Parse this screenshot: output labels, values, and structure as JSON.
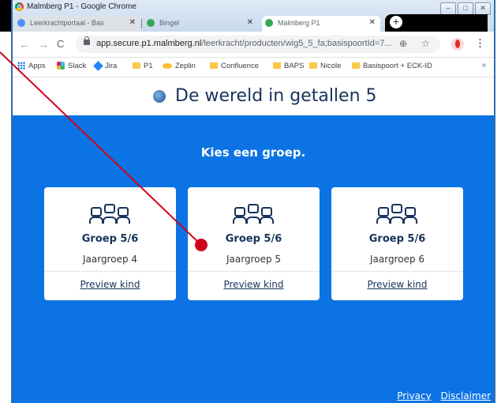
{
  "window": {
    "title": "Malmberg P1 - Google Chrome",
    "controls": [
      "–",
      "□",
      "✕"
    ]
  },
  "tabs": [
    {
      "label": "Leerkrachtportaal - Bas",
      "close": "✕",
      "icon_color": "#4d90fe"
    },
    {
      "label": "Bingel",
      "close": "✕",
      "icon_color": "#34a853"
    },
    {
      "label": "Malmberg P1",
      "close": "✕",
      "icon_color": "#34a853"
    }
  ],
  "new_tab": "+",
  "toolbar": {
    "back": "←",
    "forward": "→",
    "reload": "C",
    "url_domain": "app.secure.p1.malmberg.nl",
    "url_path": "/leerkracht/producten/wig5_5_fa;basispoortId=7...",
    "zoom_icon": "⊕",
    "star_icon": "☆",
    "menu": "⋮"
  },
  "bookmarks": [
    {
      "label": "Apps",
      "icon": "apps-icon"
    },
    {
      "label": "Slack",
      "icon": "slack-icon"
    },
    {
      "label": "Jira",
      "icon": "jira-icon"
    },
    {
      "label": "P1",
      "icon": "folder-icon"
    },
    {
      "label": "Zeplin",
      "icon": "zeplin-icon"
    },
    {
      "label": "Confluence",
      "icon": "folder-icon"
    },
    {
      "label": "BAPS",
      "icon": "folder-icon"
    },
    {
      "label": "Nicole",
      "icon": "folder-icon"
    },
    {
      "label": "Basispoort + ECK-ID",
      "icon": "folder-icon"
    }
  ],
  "bookmarks_more": "»",
  "app": {
    "title": "De wereld in getallen 5",
    "prompt": "Kies een groep.",
    "accent_color": "#0b73e3",
    "groups": [
      {
        "name": "Groep 5/6",
        "grade": "Jaargroep 4",
        "action": "Preview kind"
      },
      {
        "name": "Groep 5/6",
        "grade": "Jaargroep 5",
        "action": "Preview kind"
      },
      {
        "name": "Groep 5/6",
        "grade": "Jaargroep 6",
        "action": "Preview kind"
      }
    ],
    "footer": {
      "privacy": "Privacy",
      "disclaimer": "Disclaimer"
    }
  },
  "annotation": {
    "color": "#d0021b"
  }
}
